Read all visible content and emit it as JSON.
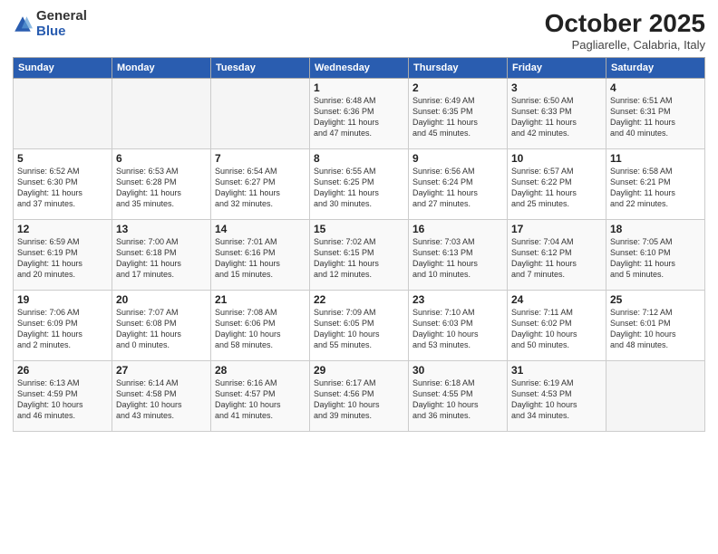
{
  "header": {
    "logo_general": "General",
    "logo_blue": "Blue",
    "title": "October 2025",
    "subtitle": "Pagliarelle, Calabria, Italy"
  },
  "weekdays": [
    "Sunday",
    "Monday",
    "Tuesday",
    "Wednesday",
    "Thursday",
    "Friday",
    "Saturday"
  ],
  "weeks": [
    [
      {
        "day": "",
        "info": ""
      },
      {
        "day": "",
        "info": ""
      },
      {
        "day": "",
        "info": ""
      },
      {
        "day": "1",
        "info": "Sunrise: 6:48 AM\nSunset: 6:36 PM\nDaylight: 11 hours\nand 47 minutes."
      },
      {
        "day": "2",
        "info": "Sunrise: 6:49 AM\nSunset: 6:35 PM\nDaylight: 11 hours\nand 45 minutes."
      },
      {
        "day": "3",
        "info": "Sunrise: 6:50 AM\nSunset: 6:33 PM\nDaylight: 11 hours\nand 42 minutes."
      },
      {
        "day": "4",
        "info": "Sunrise: 6:51 AM\nSunset: 6:31 PM\nDaylight: 11 hours\nand 40 minutes."
      }
    ],
    [
      {
        "day": "5",
        "info": "Sunrise: 6:52 AM\nSunset: 6:30 PM\nDaylight: 11 hours\nand 37 minutes."
      },
      {
        "day": "6",
        "info": "Sunrise: 6:53 AM\nSunset: 6:28 PM\nDaylight: 11 hours\nand 35 minutes."
      },
      {
        "day": "7",
        "info": "Sunrise: 6:54 AM\nSunset: 6:27 PM\nDaylight: 11 hours\nand 32 minutes."
      },
      {
        "day": "8",
        "info": "Sunrise: 6:55 AM\nSunset: 6:25 PM\nDaylight: 11 hours\nand 30 minutes."
      },
      {
        "day": "9",
        "info": "Sunrise: 6:56 AM\nSunset: 6:24 PM\nDaylight: 11 hours\nand 27 minutes."
      },
      {
        "day": "10",
        "info": "Sunrise: 6:57 AM\nSunset: 6:22 PM\nDaylight: 11 hours\nand 25 minutes."
      },
      {
        "day": "11",
        "info": "Sunrise: 6:58 AM\nSunset: 6:21 PM\nDaylight: 11 hours\nand 22 minutes."
      }
    ],
    [
      {
        "day": "12",
        "info": "Sunrise: 6:59 AM\nSunset: 6:19 PM\nDaylight: 11 hours\nand 20 minutes."
      },
      {
        "day": "13",
        "info": "Sunrise: 7:00 AM\nSunset: 6:18 PM\nDaylight: 11 hours\nand 17 minutes."
      },
      {
        "day": "14",
        "info": "Sunrise: 7:01 AM\nSunset: 6:16 PM\nDaylight: 11 hours\nand 15 minutes."
      },
      {
        "day": "15",
        "info": "Sunrise: 7:02 AM\nSunset: 6:15 PM\nDaylight: 11 hours\nand 12 minutes."
      },
      {
        "day": "16",
        "info": "Sunrise: 7:03 AM\nSunset: 6:13 PM\nDaylight: 11 hours\nand 10 minutes."
      },
      {
        "day": "17",
        "info": "Sunrise: 7:04 AM\nSunset: 6:12 PM\nDaylight: 11 hours\nand 7 minutes."
      },
      {
        "day": "18",
        "info": "Sunrise: 7:05 AM\nSunset: 6:10 PM\nDaylight: 11 hours\nand 5 minutes."
      }
    ],
    [
      {
        "day": "19",
        "info": "Sunrise: 7:06 AM\nSunset: 6:09 PM\nDaylight: 11 hours\nand 2 minutes."
      },
      {
        "day": "20",
        "info": "Sunrise: 7:07 AM\nSunset: 6:08 PM\nDaylight: 11 hours\nand 0 minutes."
      },
      {
        "day": "21",
        "info": "Sunrise: 7:08 AM\nSunset: 6:06 PM\nDaylight: 10 hours\nand 58 minutes."
      },
      {
        "day": "22",
        "info": "Sunrise: 7:09 AM\nSunset: 6:05 PM\nDaylight: 10 hours\nand 55 minutes."
      },
      {
        "day": "23",
        "info": "Sunrise: 7:10 AM\nSunset: 6:03 PM\nDaylight: 10 hours\nand 53 minutes."
      },
      {
        "day": "24",
        "info": "Sunrise: 7:11 AM\nSunset: 6:02 PM\nDaylight: 10 hours\nand 50 minutes."
      },
      {
        "day": "25",
        "info": "Sunrise: 7:12 AM\nSunset: 6:01 PM\nDaylight: 10 hours\nand 48 minutes."
      }
    ],
    [
      {
        "day": "26",
        "info": "Sunrise: 6:13 AM\nSunset: 4:59 PM\nDaylight: 10 hours\nand 46 minutes."
      },
      {
        "day": "27",
        "info": "Sunrise: 6:14 AM\nSunset: 4:58 PM\nDaylight: 10 hours\nand 43 minutes."
      },
      {
        "day": "28",
        "info": "Sunrise: 6:16 AM\nSunset: 4:57 PM\nDaylight: 10 hours\nand 41 minutes."
      },
      {
        "day": "29",
        "info": "Sunrise: 6:17 AM\nSunset: 4:56 PM\nDaylight: 10 hours\nand 39 minutes."
      },
      {
        "day": "30",
        "info": "Sunrise: 6:18 AM\nSunset: 4:55 PM\nDaylight: 10 hours\nand 36 minutes."
      },
      {
        "day": "31",
        "info": "Sunrise: 6:19 AM\nSunset: 4:53 PM\nDaylight: 10 hours\nand 34 minutes."
      },
      {
        "day": "",
        "info": ""
      }
    ]
  ]
}
